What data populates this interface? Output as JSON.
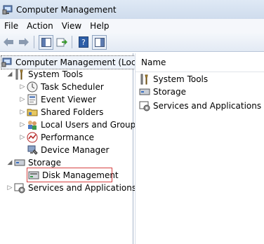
{
  "window": {
    "title": "Computer Management"
  },
  "menu": [
    "File",
    "Action",
    "View",
    "Help"
  ],
  "toolbar": {
    "buttons": [
      "back-icon",
      "forward-icon",
      "show-hide-tree-icon",
      "up-level-icon",
      "help-icon",
      "properties-icon"
    ]
  },
  "tree": {
    "root": "Computer Management (Local",
    "system_tools": "System Tools",
    "task_scheduler": "Task Scheduler",
    "event_viewer": "Event Viewer",
    "shared_folders": "Shared Folders",
    "local_users": "Local Users and Groups",
    "performance": "Performance",
    "device_manager": "Device Manager",
    "storage": "Storage",
    "disk_management": "Disk Management",
    "services": "Services and Applications"
  },
  "list": {
    "header": "Name",
    "items": [
      "System Tools",
      "Storage",
      "Services and Applications"
    ]
  },
  "colors": {
    "highlight_border": "#d64040",
    "title_bg": "#dfe9f5"
  }
}
